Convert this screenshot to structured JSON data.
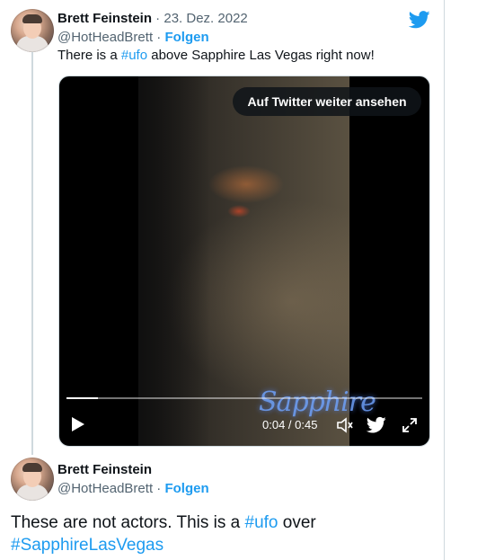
{
  "tweet1": {
    "author_name": "Brett Feinstein",
    "separator": " · ",
    "date": "23. Dez. 2022",
    "handle": "@HotHeadBrett",
    "follow_label": "Folgen",
    "text_before": "There is a ",
    "hashtag": "#ufo",
    "text_after": " above Sapphire Las Vegas right now!"
  },
  "video": {
    "watch_button_label": "Auf Twitter weiter ansehen",
    "overlay_logo_text": "Sapphire",
    "time_display": "0:04 / 0:45",
    "progress_fraction": 0.089,
    "icons": [
      "play-icon",
      "volume-icon",
      "twitter-bird-icon",
      "fullscreen-icon"
    ]
  },
  "tweet2": {
    "author_name": "Brett Feinstein",
    "handle": "@HotHeadBrett",
    "separator": " · ",
    "follow_label": "Folgen",
    "text_before": "These are not actors. This is a ",
    "hashtag": "#ufo",
    "text_after": " over",
    "hashtag2": "#SapphireLasVegas"
  },
  "colors": {
    "accent": "#1d9bf0",
    "text": "#0f1419",
    "secondary": "#536471"
  }
}
